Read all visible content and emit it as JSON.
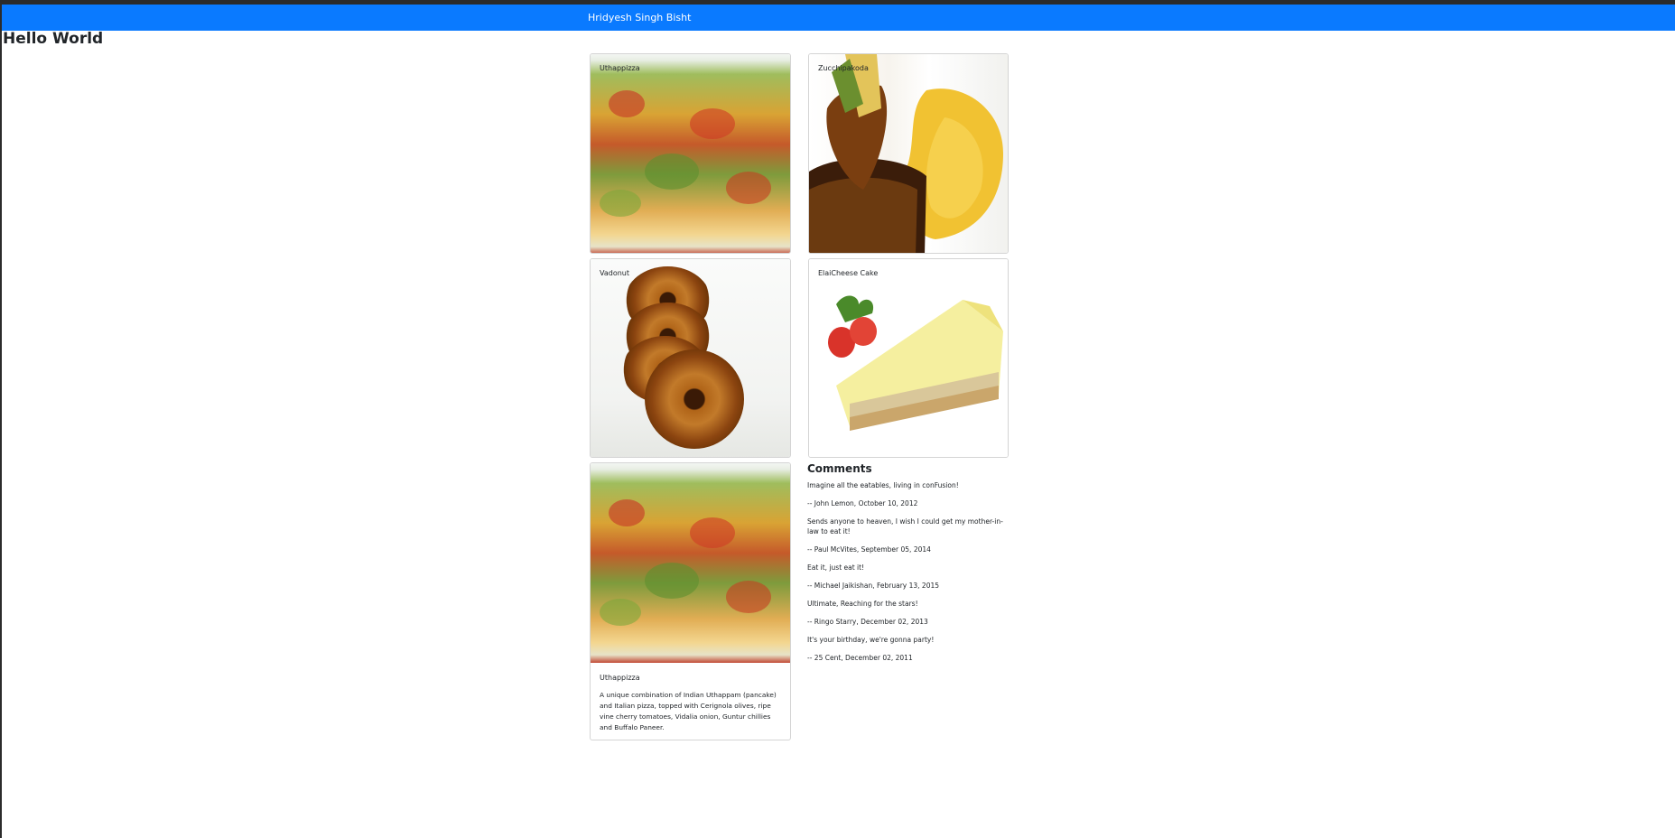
{
  "navbar": {
    "brand": "Hridyesh Singh Bisht"
  },
  "page": {
    "heading": "Hello World"
  },
  "dishes": [
    {
      "name": "Uthappizza"
    },
    {
      "name": "Zucchipakoda"
    },
    {
      "name": "Vadonut"
    },
    {
      "name": "ElaiCheese Cake"
    }
  ],
  "selected_dish": {
    "name": "Uthappizza",
    "description": "A unique combination of Indian Uthappam (pancake) and Italian pizza, topped with Cerignola olives, ripe vine cherry tomatoes, Vidalia onion, Guntur chillies and Buffalo Paneer."
  },
  "comments": {
    "title": "Comments",
    "items": [
      {
        "text": "Imagine all the eatables, living in conFusion!",
        "author": "-- John Lemon,  October 10, 2012"
      },
      {
        "text": "Sends anyone to heaven, I wish I could get my mother-in-law to eat it!",
        "author": "-- Paul McVites,  September 05, 2014"
      },
      {
        "text": "Eat it, just eat it!",
        "author": "-- Michael Jaikishan,  February 13, 2015"
      },
      {
        "text": "Ultimate, Reaching for the stars!",
        "author": "-- Ringo Starry,  December 02, 2013"
      },
      {
        "text": "It's your birthday, we're gonna party!",
        "author": "-- 25 Cent,  December 02, 2011"
      }
    ]
  },
  "colors": {
    "navbar": "#0a7aff",
    "card_border": "#d4d4d4"
  }
}
